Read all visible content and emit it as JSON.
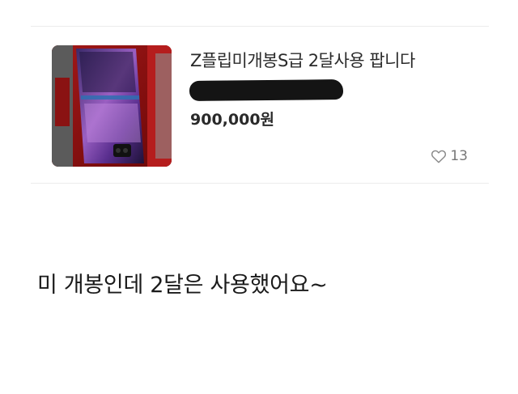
{
  "listing": {
    "title": "Z플립미개봉S급 2달사용 팝니다",
    "price": "900,000원",
    "like_count": "13",
    "like_icon": "heart-outline-icon",
    "thumbnail": "phone-photo"
  },
  "caption": "미 개봉인데 2달은 사용했어요~",
  "colors": {
    "text": "#2a2a2a",
    "muted": "#777777",
    "divider": "#ececec",
    "redaction": "#141414"
  }
}
